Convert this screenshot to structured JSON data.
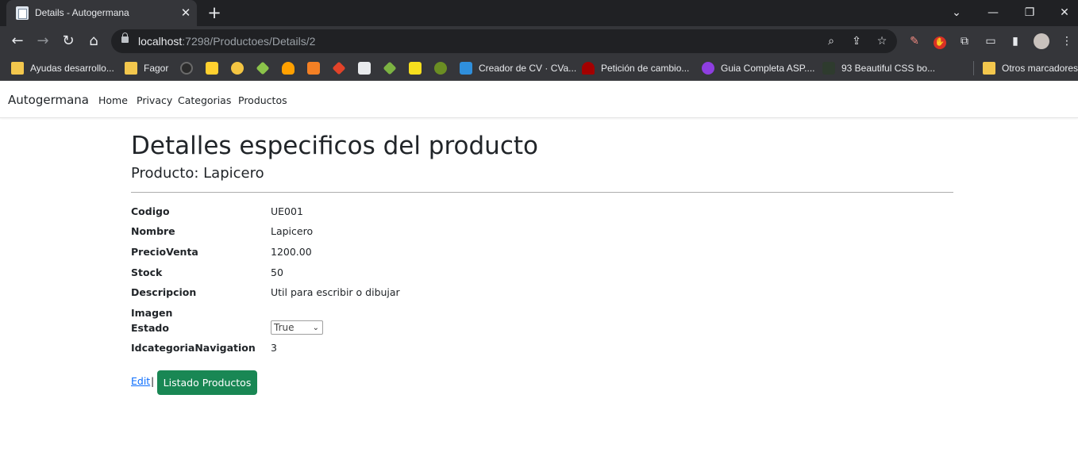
{
  "browser": {
    "tab_title": "Details - Autogermana",
    "url_host": "localhost",
    "url_path": ":7298/Productoes/Details/2",
    "bookmarks": [
      {
        "label": "Ayudas desarrollo...",
        "icon": "folder-icon"
      },
      {
        "label": "Fagor",
        "icon": "folder-icon"
      },
      {
        "label": "Creador de CV · CVa...",
        "icon": "cv-icon"
      },
      {
        "label": "Petición de cambio...",
        "icon": "redhat-icon"
      },
      {
        "label": "Guia Completa ASP....",
        "icon": "purple-u-icon"
      },
      {
        "label": "93 Beautiful CSS bo...",
        "icon": "css-icon"
      },
      {
        "label": "Otros marcadores",
        "icon": "folder-icon"
      }
    ]
  },
  "navbar": {
    "brand": "Autogermana",
    "links": [
      "Home",
      "Privacy",
      "Categorias",
      "Productos"
    ]
  },
  "page": {
    "title": "Detalles especificos del producto",
    "subtitle": "Producto: Lapicero",
    "fields": [
      {
        "label": "Codigo",
        "value": "UE001"
      },
      {
        "label": "Nombre",
        "value": "Lapicero"
      },
      {
        "label": "PrecioVenta",
        "value": "1200.00"
      },
      {
        "label": "Stock",
        "value": "50"
      },
      {
        "label": "Descripcion",
        "value": "Util para escribir o dibujar"
      },
      {
        "label": "Imagen",
        "value": ""
      },
      {
        "label": "Estado",
        "value": "True"
      },
      {
        "label": "IdcategoriaNavigation",
        "value": "3"
      }
    ],
    "edit_label": "Edit",
    "separator": "|",
    "list_button_label": "Listado Productos"
  },
  "colors": {
    "success": "#198754",
    "link": "#0d6efd",
    "chrome_dark": "#202124",
    "chrome_toolbar": "#35363a"
  }
}
